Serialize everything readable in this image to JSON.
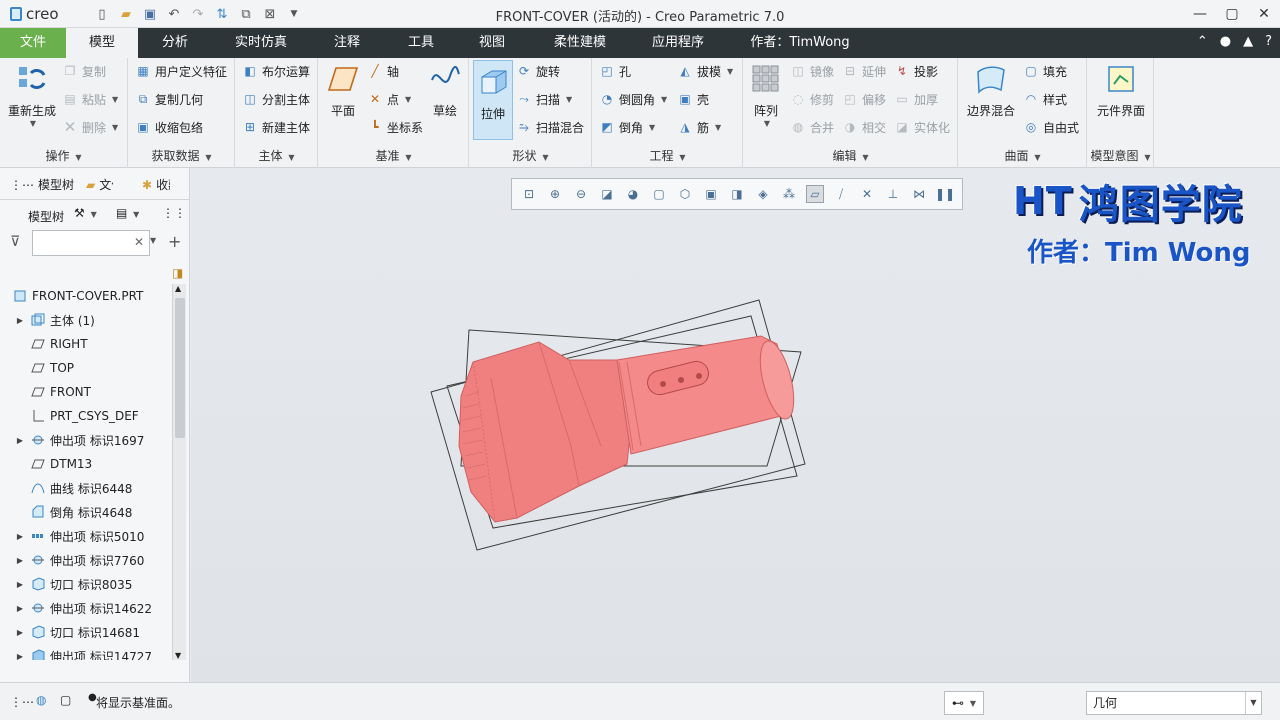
{
  "app": {
    "logo_text": "creo",
    "window_title": "FRONT-COVER (活动的) - Creo Parametric 7.0"
  },
  "tabs": [
    {
      "label": "文件"
    },
    {
      "label": "模型"
    },
    {
      "label": "分析"
    },
    {
      "label": "实时仿真"
    },
    {
      "label": "注释"
    },
    {
      "label": "工具"
    },
    {
      "label": "视图"
    },
    {
      "label": "柔性建模"
    },
    {
      "label": "应用程序"
    },
    {
      "label": "作者：TimWong"
    }
  ],
  "ribbon": {
    "operations": {
      "label": "操作",
      "regenerate": "重新生成",
      "copy": "复制",
      "paste": "粘贴",
      "delete": "删除"
    },
    "get_data": {
      "label": "获取数据",
      "udf": "用户定义特征",
      "copy_geom": "复制几何",
      "shrinkwrap": "收缩包络"
    },
    "body": {
      "label": "主体",
      "boolean": "布尔运算",
      "split": "分割主体",
      "new_body": "新建主体"
    },
    "datum": {
      "label": "基准",
      "plane": "平面",
      "axis": "轴",
      "point": "点",
      "csys": "坐标系",
      "sketch": "草绘"
    },
    "shapes": {
      "label": "形状",
      "extrude": "拉伸",
      "revolve": "旋转",
      "sweep": "扫描",
      "swept_blend": "扫描混合"
    },
    "engineering": {
      "label": "工程",
      "hole": "孔",
      "round": "倒圆角",
      "chamfer": "倒角",
      "draft": "拔模",
      "shell": "壳",
      "rib": "筋"
    },
    "editing": {
      "label": "编辑",
      "pattern": "阵列",
      "mirror": "镜像",
      "trim": "修剪",
      "merge": "合并",
      "extend": "延伸",
      "offset": "偏移",
      "intersect": "相交",
      "project": "投影",
      "thicken": "加厚",
      "solidify": "实体化"
    },
    "surfaces": {
      "label": "曲面",
      "boundary_blend": "边界混合",
      "fill": "填充",
      "style": "样式",
      "freestyle": "自由式"
    },
    "model_intent": {
      "label": "模型意图",
      "component_interface": "元件界面"
    }
  },
  "left_panel": {
    "tabs": [
      "模型树",
      "文件",
      "收藏"
    ],
    "tree_title": "模型树",
    "search_placeholder": "",
    "tree": [
      {
        "label": "FRONT-COVER.PRT",
        "icon": "part-icon",
        "expand": false,
        "indent": 0
      },
      {
        "label": "主体 (1)",
        "icon": "body-icon",
        "expand": true,
        "indent": 1
      },
      {
        "label": "RIGHT",
        "icon": "datum-plane-icon",
        "expand": false,
        "indent": 1
      },
      {
        "label": "TOP",
        "icon": "datum-plane-icon",
        "expand": false,
        "indent": 1
      },
      {
        "label": "FRONT",
        "icon": "datum-plane-icon",
        "expand": false,
        "indent": 1
      },
      {
        "label": "PRT_CSYS_DEF",
        "icon": "csys-icon",
        "expand": false,
        "indent": 1
      },
      {
        "label": "伸出项 标识1697",
        "icon": "revolve-icon",
        "expand": true,
        "indent": 1
      },
      {
        "label": "DTM13",
        "icon": "datum-plane-icon",
        "expand": false,
        "indent": 1
      },
      {
        "label": "曲线 标识6448",
        "icon": "curve-icon",
        "expand": false,
        "indent": 1
      },
      {
        "label": "倒角 标识4648",
        "icon": "chamfer-icon",
        "expand": false,
        "indent": 1
      },
      {
        "label": "伸出项 标识5010",
        "icon": "pattern-icon",
        "expand": true,
        "indent": 1
      },
      {
        "label": "伸出项 标识7760",
        "icon": "revolve-icon",
        "expand": true,
        "indent": 1
      },
      {
        "label": "切口 标识8035",
        "icon": "cut-icon",
        "expand": true,
        "indent": 1
      },
      {
        "label": "伸出项 标识14622",
        "icon": "revolve-icon",
        "expand": true,
        "indent": 1
      },
      {
        "label": "切口 标识14681",
        "icon": "cut-icon",
        "expand": true,
        "indent": 1
      },
      {
        "label": "伸出项 标识14727",
        "icon": "extrude-icon",
        "expand": true,
        "indent": 1
      }
    ]
  },
  "watermark": {
    "logo": "HT",
    "title": "鸿图学院",
    "author": "作者：Tim Wong"
  },
  "status": {
    "message": "将显示基准面。",
    "selection_filter": "几何"
  },
  "colors": {
    "accent": "#6ab04c",
    "tabbar": "#2d3539",
    "model": "#f08080"
  }
}
